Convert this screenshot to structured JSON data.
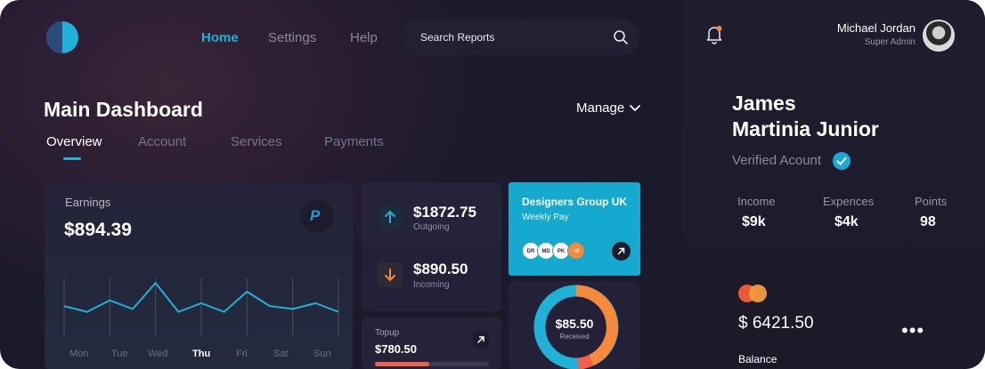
{
  "header": {
    "nav": [
      "Home",
      "Settings",
      "Help"
    ],
    "search_placeholder": "Search Reports",
    "user_name": "Michael Jordan",
    "user_role": "Super Admin"
  },
  "page": {
    "title": "Main Dashboard",
    "manage_label": "Manage",
    "tabs": [
      "Overview",
      "Account",
      "Services",
      "Payments"
    ],
    "active_tab": "Overview"
  },
  "earnings": {
    "label": "Earnings",
    "value": "$894.39",
    "days": [
      "Mon",
      "Tue",
      "Wed",
      "Thu",
      "Fri",
      "Sat",
      "Sun"
    ],
    "active_day": "Thu",
    "line_values": [
      0.55,
      0.45,
      0.65,
      0.5,
      0.95,
      0.45,
      0.6,
      0.45,
      0.8,
      0.55,
      0.5,
      0.6,
      0.45
    ]
  },
  "stats": {
    "outgoing": {
      "value": "$1872.75",
      "label": "Outgoing"
    },
    "incoming": {
      "value": "$890.50",
      "label": "Incoming"
    }
  },
  "topup": {
    "label": "Topup",
    "value": "$780.50",
    "progress": 0.48
  },
  "group": {
    "title": "Designers Group UK",
    "subtitle": "Weekly Pay",
    "members": [
      "DR",
      "MD",
      "PK",
      "+8"
    ]
  },
  "donut": {
    "value": "$85.50",
    "label": "Received"
  },
  "profile": {
    "name_line1": "James",
    "name_line2": "Martinia Junior",
    "verified_label": "Verified Acount",
    "metrics": [
      {
        "label": "Income",
        "value": "$9k"
      },
      {
        "label": "Expences",
        "value": "$4k"
      },
      {
        "label": "Points",
        "value": "98"
      }
    ],
    "card_balance": "$ 6421.50",
    "card_menu": "•••",
    "balance_label": "Balance"
  },
  "colors": {
    "accent": "#1fb2d6",
    "orange": "#f58a3b",
    "red": "#f0614b"
  }
}
